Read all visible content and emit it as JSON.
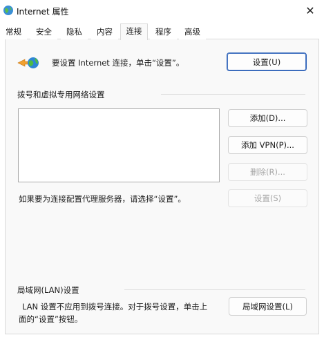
{
  "window": {
    "title": "Internet 属性",
    "close_glyph": "✕"
  },
  "tabs": [
    {
      "label": "常规",
      "active": false
    },
    {
      "label": "安全",
      "active": false
    },
    {
      "label": "隐私",
      "active": false
    },
    {
      "label": "内容",
      "active": false
    },
    {
      "label": "连接",
      "active": true
    },
    {
      "label": "程序",
      "active": false
    },
    {
      "label": "高级",
      "active": false
    }
  ],
  "setup": {
    "text": "要设置 Internet 连接，单击“设置”。",
    "button": "设置(U)"
  },
  "dialup": {
    "group_label": "拨号和虚拟专用网络设置",
    "add_button": "添加(D)...",
    "add_vpn_button": "添加 VPN(P)...",
    "delete_button": "删除(R)...",
    "proxy_text": "如果要为连接配置代理服务器，请选择“设置”。",
    "settings_button": "设置(S)"
  },
  "lan": {
    "group_label": "局域网(LAN)设置",
    "desc_line1": "LAN 设置不应用到拨号连接。对于拨号设置，单击上",
    "desc_line2": "面的“设置”按钮。",
    "button": "局域网设置(L)"
  },
  "colors": {
    "accent": "#2f63b8",
    "panel_bg": "#f9f9f9",
    "disabled_text": "#a6a6a6"
  }
}
